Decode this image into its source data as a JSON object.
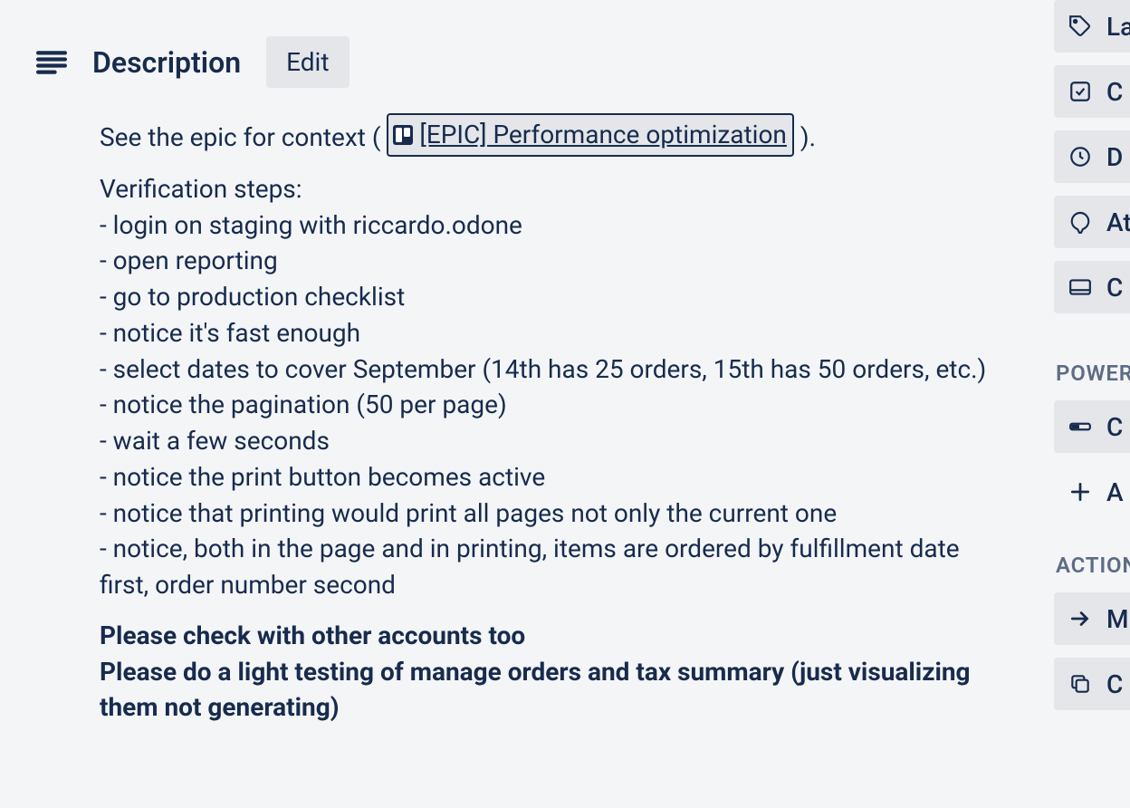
{
  "description": {
    "title": "Description",
    "edit_label": "Edit",
    "intro_prefix": "See the epic for context ( ",
    "epic_link_text": "[EPIC] Performance optimization",
    "intro_suffix": " ).",
    "verification_heading": "Verification steps:",
    "steps": [
      "- login on staging with riccardo.odone",
      "- open reporting",
      "- go to production checklist",
      "- notice it's fast enough",
      "- select dates to cover September (14th has 25 orders, 15th has 50 orders, etc.)",
      "- notice the pagination (50 per page)",
      "- wait a few seconds",
      "- notice the print button becomes active",
      "- notice that printing would print all pages not only the current one",
      "- notice, both in the page and in printing, items are ordered by fulfillment date first, order number second"
    ],
    "bold_lines": [
      "Please check with other accounts too",
      "Please do a light testing of manage orders and tax summary (just visualizing them not generating)"
    ]
  },
  "sidebar": {
    "items_top": [
      {
        "label": "La"
      },
      {
        "label": "C"
      },
      {
        "label": "D"
      },
      {
        "label": "At"
      },
      {
        "label": "C"
      }
    ],
    "section_powerups_label": "POWER",
    "powerups": [
      {
        "label": "C"
      }
    ],
    "add_label": "A",
    "section_actions_label": "ACTION",
    "actions": [
      {
        "label": "M"
      },
      {
        "label": "C"
      }
    ]
  }
}
